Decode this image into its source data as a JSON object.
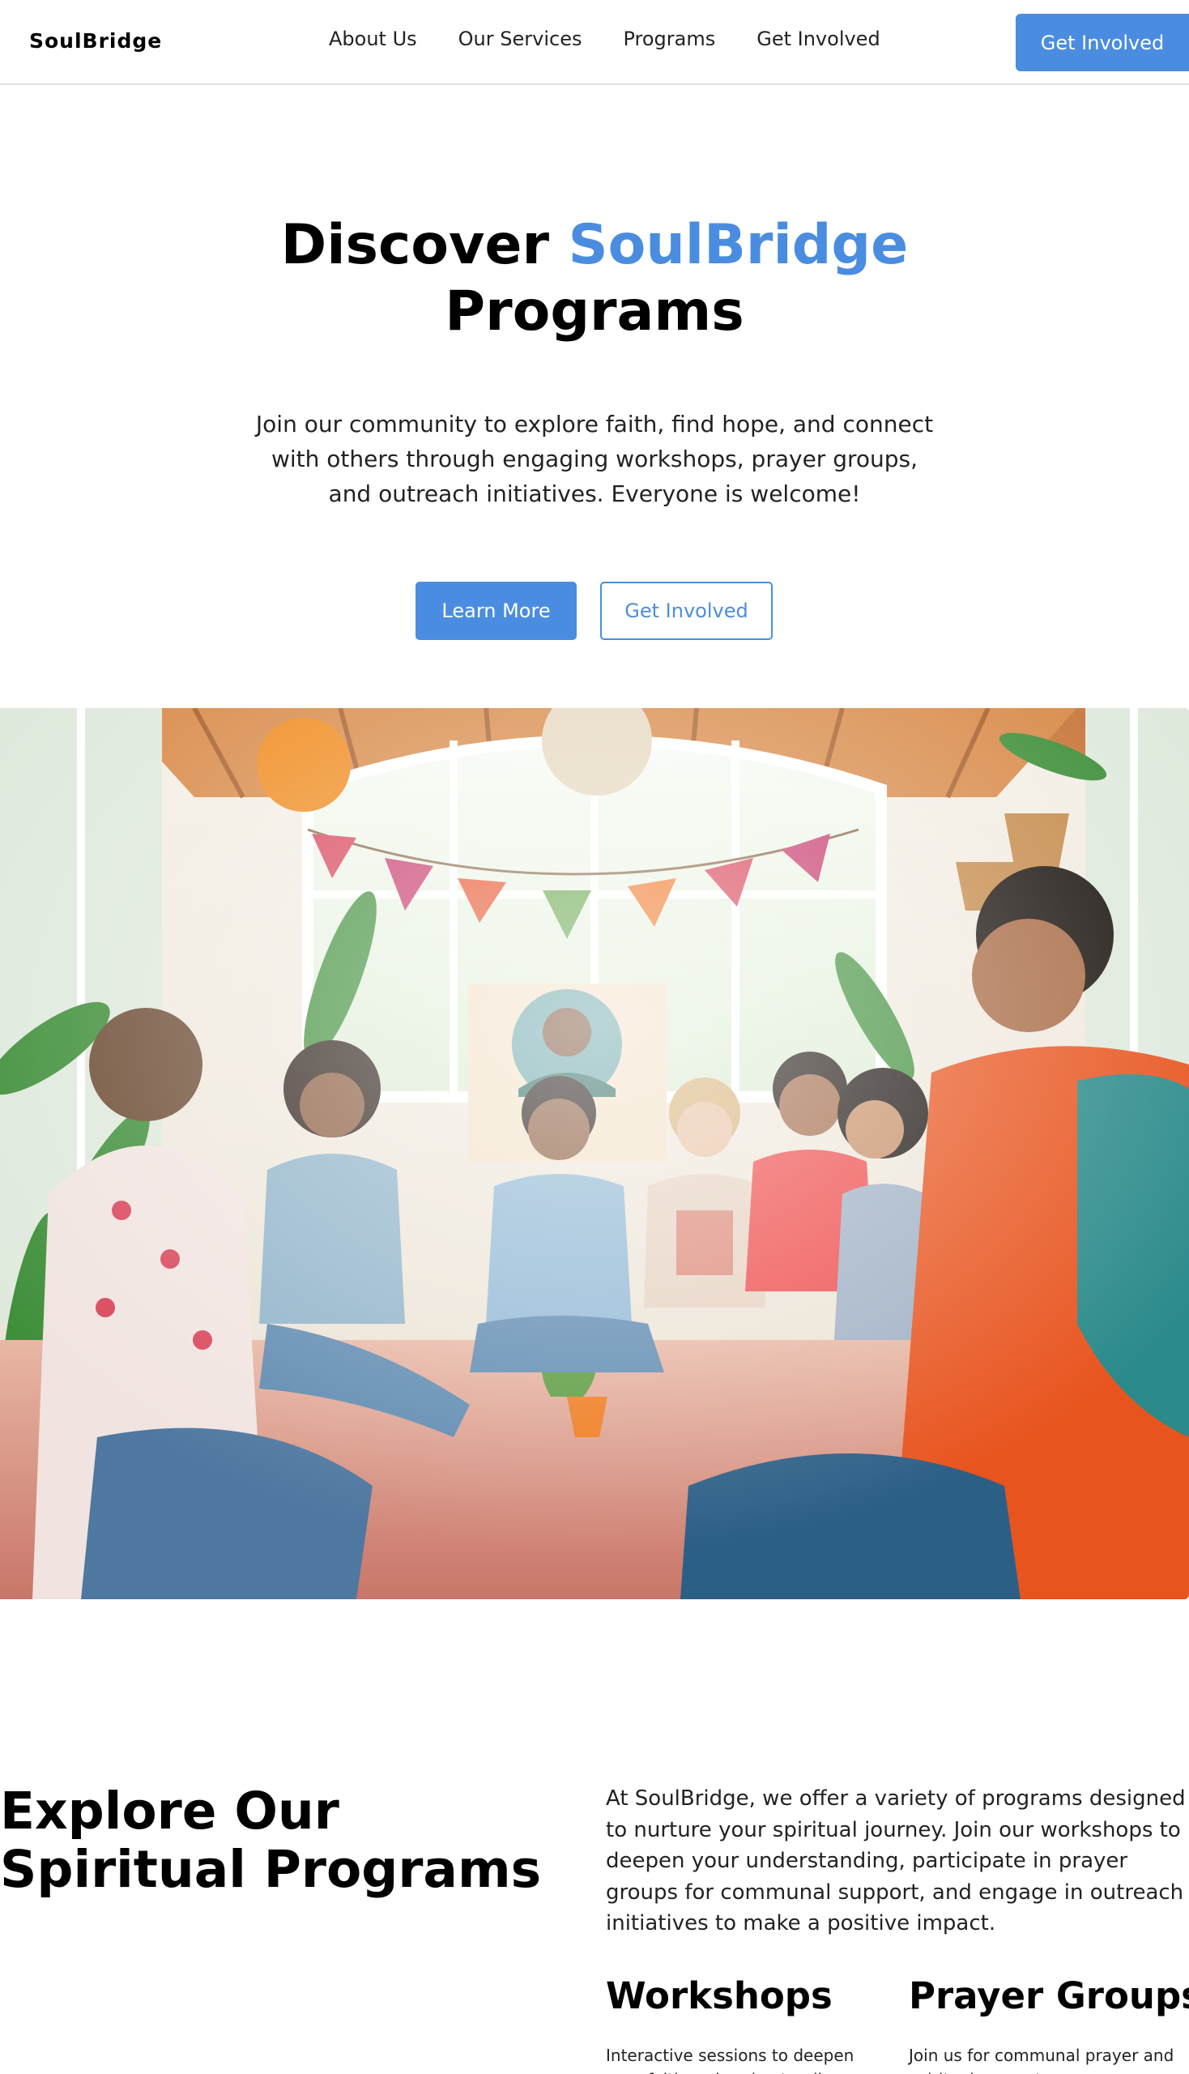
{
  "nav": {
    "logo": "SoulBridge",
    "links": [
      "About Us",
      "Our Services",
      "Programs",
      "Get Involved"
    ],
    "cta_label": "Get Involved"
  },
  "hero": {
    "title_part1": "Discover ",
    "title_accent": "SoulBridge",
    "title_part2": "Programs",
    "subtitle": "Join our community to explore faith, find hope, and connect with others through engaging workshops, prayer groups, and outreach initiatives. Everyone is welcome!",
    "primary_button": "Learn More",
    "secondary_button": "Get Involved"
  },
  "explore": {
    "title": "Explore Our Spiritual Programs",
    "description": "At SoulBridge, we offer a variety of programs designed to nurture your spiritual journey. Join our workshops to deepen your understanding, participate in prayer groups for communal support, and engage in outreach initiatives to make a positive impact.",
    "cards": [
      {
        "title": "Workshops",
        "text": "Interactive sessions to deepen your faith and understanding."
      },
      {
        "title": "Prayer Groups",
        "text": "Join us for communal prayer and spiritual support."
      }
    ]
  },
  "colors": {
    "accent": "#4a8de0",
    "text": "#222222",
    "heading": "#000000"
  }
}
